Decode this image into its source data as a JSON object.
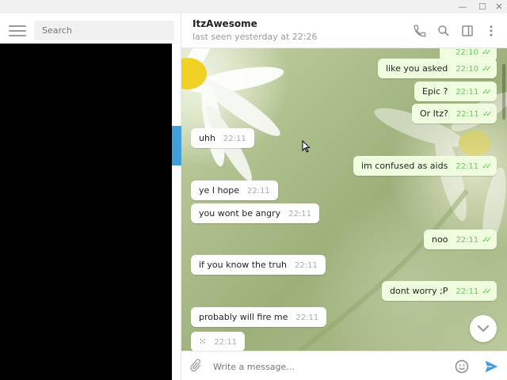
{
  "window": {
    "controls": [
      "minimize-icon",
      "maximize-icon",
      "close-icon"
    ],
    "minimize_glyph": "—",
    "maximize_glyph": "☐",
    "close_glyph": "✕"
  },
  "sidebar": {
    "search_placeholder": "Search",
    "accent_color": "#419fd9"
  },
  "chat": {
    "name": "ItzAwesome",
    "status": "last seen yesterday at 22:26",
    "header_icons": [
      "phone-icon",
      "search-icon",
      "sidebar-toggle-icon",
      "more-vert-icon"
    ]
  },
  "messages": [
    {
      "direction": "out",
      "text": "",
      "time": "22:10",
      "read": true,
      "partial": true
    },
    {
      "direction": "out",
      "text": "like you asked",
      "time": "22:10",
      "read": true
    },
    {
      "direction": "out",
      "text": "Epic ?",
      "time": "22:11",
      "read": true
    },
    {
      "direction": "out",
      "text": "Or Itz?",
      "time": "22:11",
      "read": true
    },
    {
      "direction": "in",
      "text": "uhh",
      "time": "22:11"
    },
    {
      "direction": "out",
      "text": "im confused as aids",
      "time": "22:11",
      "read": true
    },
    {
      "direction": "in",
      "text": "ye I hope",
      "time": "22:11"
    },
    {
      "direction": "in",
      "text": "you wont be angry",
      "time": "22:11"
    },
    {
      "direction": "out",
      "text": "noo",
      "time": "22:11",
      "read": true
    },
    {
      "direction": "in",
      "text": "if you know the truh",
      "time": "22:11"
    },
    {
      "direction": "out",
      "text": "dont worry ;P",
      "time": "22:11",
      "read": true
    },
    {
      "direction": "in",
      "text": "probably will fire me",
      "time": "22:11"
    },
    {
      "direction": "in",
      "text": "⁙",
      "time": "22:11"
    }
  ],
  "composer": {
    "placeholder": "Write a message..."
  },
  "colors": {
    "outgoing_bubble": "#effdde",
    "incoming_bubble": "#ffffff",
    "read_ticks": "#5dc452",
    "send_button": "#419fd9"
  }
}
